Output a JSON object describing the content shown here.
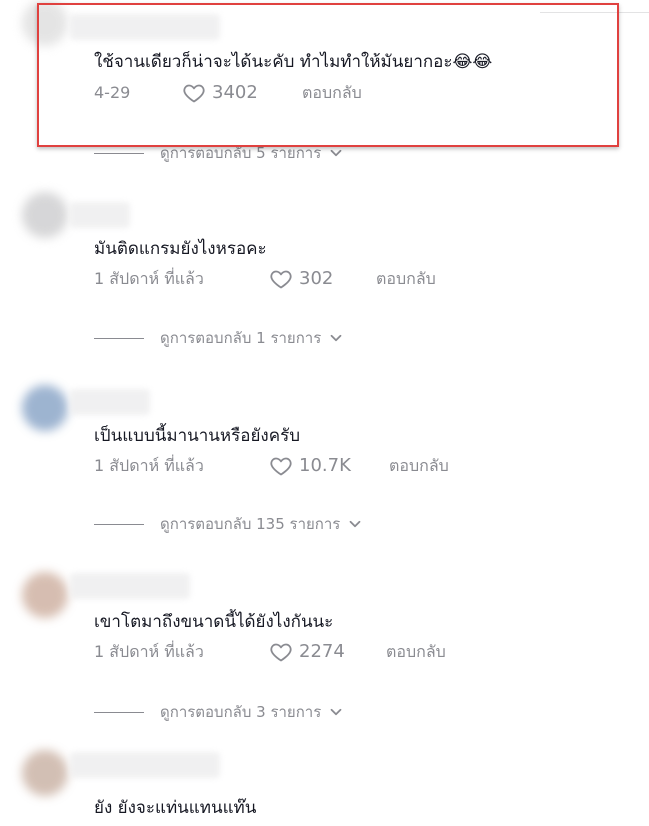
{
  "highlight_color": "#e0413f",
  "icons": {
    "like": "heart-outline-icon",
    "expand": "chevron-down-icon"
  },
  "comments": [
    {
      "text": "ใช้จานเดียวก็น่าจะได้นะคับ ทำไมทำให้มันยากอะ😂😂",
      "date": "4-29",
      "likes": "3402",
      "reply_label": "ตอบกลับ",
      "view_replies": "ดูการตอบกลับ 5 รายการ"
    },
    {
      "text": "มันติดแกรมยังไงหรอคะ",
      "date": "1 สัปดาห์ ที่แล้ว",
      "likes": "302",
      "reply_label": "ตอบกลับ",
      "view_replies": "ดูการตอบกลับ 1 รายการ"
    },
    {
      "text": "เป็นแบบนี้มานานหรือยังครับ",
      "date": "1 สัปดาห์ ที่แล้ว",
      "likes": "10.7K",
      "reply_label": "ตอบกลับ",
      "view_replies": "ดูการตอบกลับ 135 รายการ"
    },
    {
      "text": "เขาโตมาถึงขนาดนี้ได้ยังไงกันนะ",
      "date": "1 สัปดาห์ ที่แล้ว",
      "likes": "2274",
      "reply_label": "ตอบกลับ",
      "view_replies": "ดูการตอบกลับ 3 รายการ"
    },
    {
      "text": "ยัง ยังจะแท่นแทนแท๊น"
    }
  ]
}
